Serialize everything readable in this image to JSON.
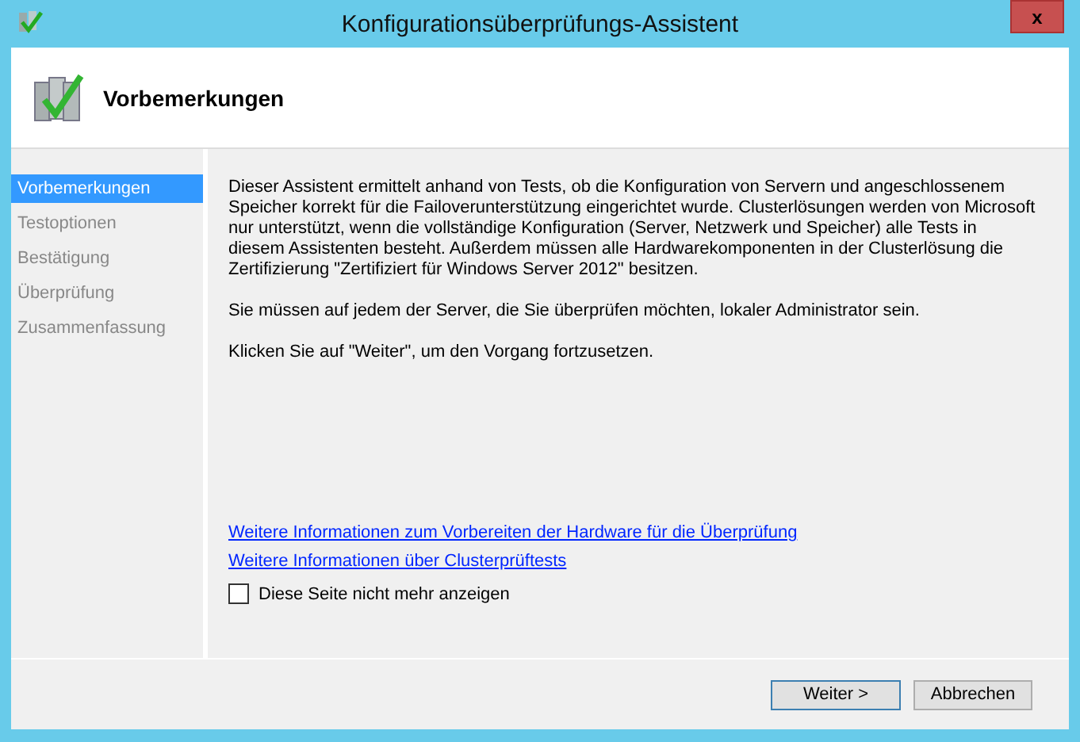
{
  "window": {
    "title": "Konfigurationsüberprüfungs-Assistent",
    "close": "x"
  },
  "header": {
    "title": "Vorbemerkungen"
  },
  "sidebar": {
    "items": [
      {
        "label": "Vorbemerkungen",
        "selected": true
      },
      {
        "label": "Testoptionen",
        "selected": false
      },
      {
        "label": "Bestätigung",
        "selected": false
      },
      {
        "label": "Überprüfung",
        "selected": false
      },
      {
        "label": "Zusammenfassung",
        "selected": false
      }
    ]
  },
  "paragraphs": [
    "Dieser Assistent ermittelt anhand von Tests, ob die Konfiguration von Servern und angeschlossenem Speicher korrekt für die Failoverunterstützung eingerichtet wurde. Clusterlösungen werden von Microsoft nur unterstützt, wenn die vollständige Konfiguration (Server, Netzwerk und Speicher) alle Tests in diesem Assistenten besteht. Außerdem müssen alle Hardwarekomponenten in der Clusterlösung die Zertifizierung \"Zertifiziert für Windows Server 2012\" besitzen.",
    "Sie müssen auf jedem der Server, die Sie überprüfen möchten, lokaler Administrator sein.",
    "Klicken Sie auf \"Weiter\", um den Vorgang fortzusetzen."
  ],
  "links": [
    "Weitere Informationen zum Vorbereiten der Hardware für die Überprüfung",
    "Weitere Informationen über Clusterprüftests"
  ],
  "checkbox": {
    "label": "Diese Seite nicht mehr anzeigen",
    "checked": false
  },
  "buttons": [
    {
      "label": "Weiter >",
      "default": true
    },
    {
      "label": "Abbrechen",
      "default": false
    }
  ]
}
